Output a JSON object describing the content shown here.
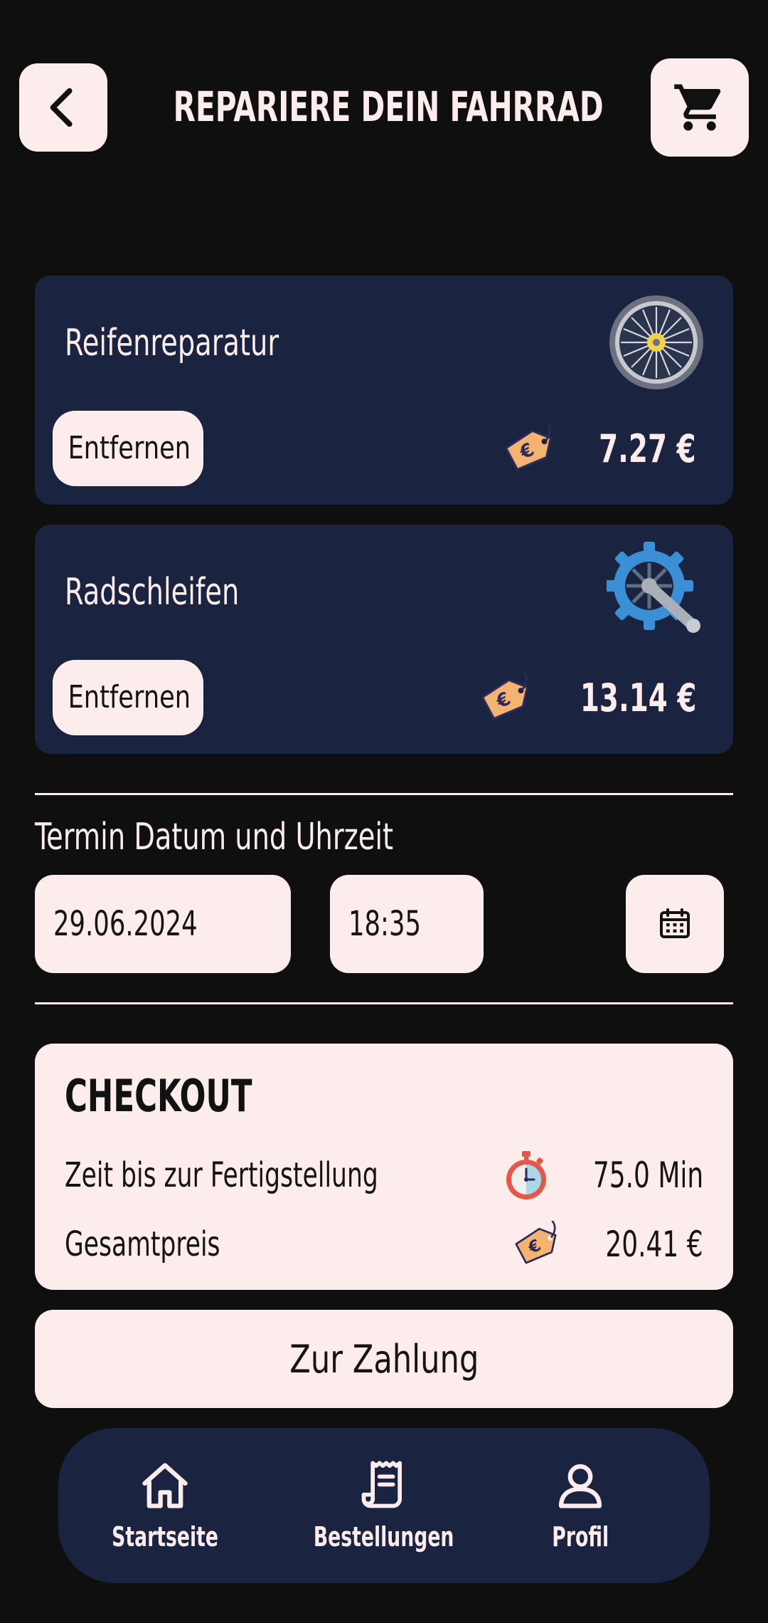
{
  "header": {
    "title": "REPARIERE DEIN FAHRRAD",
    "back_icon": "chevron-left-icon",
    "cart_icon": "shopping-cart-icon"
  },
  "services": [
    {
      "name": "Reifenreparatur",
      "remove_label": "Entfernen",
      "price": "7.27 €",
      "icon": "bicycle-wheel-icon"
    },
    {
      "name": "Radschleifen",
      "remove_label": "Entfernen",
      "price": "13.14 €",
      "icon": "gear-crank-icon"
    }
  ],
  "appointment": {
    "label": "Termin Datum und Uhrzeit",
    "date": "29.06.2024",
    "time": "18:35",
    "calendar_icon": "calendar-icon"
  },
  "checkout": {
    "title": "CHECKOUT",
    "time_label": "Zeit bis zur Fertigstellung",
    "time_value": "75.0 Min",
    "total_label": "Gesamtpreis",
    "total_value": "20.41 €"
  },
  "pay_button": "Zur Zahlung",
  "nav": {
    "items": [
      {
        "label": "Startseite",
        "icon": "home-icon"
      },
      {
        "label": "Bestellungen",
        "icon": "receipt-icon"
      },
      {
        "label": "Profil",
        "icon": "user-icon"
      }
    ]
  },
  "colors": {
    "background": "#0f0f0f",
    "card": "#1a2340",
    "light": "#fcecec",
    "price_tag": "#f4b371",
    "stopwatch": "#e4574a"
  }
}
